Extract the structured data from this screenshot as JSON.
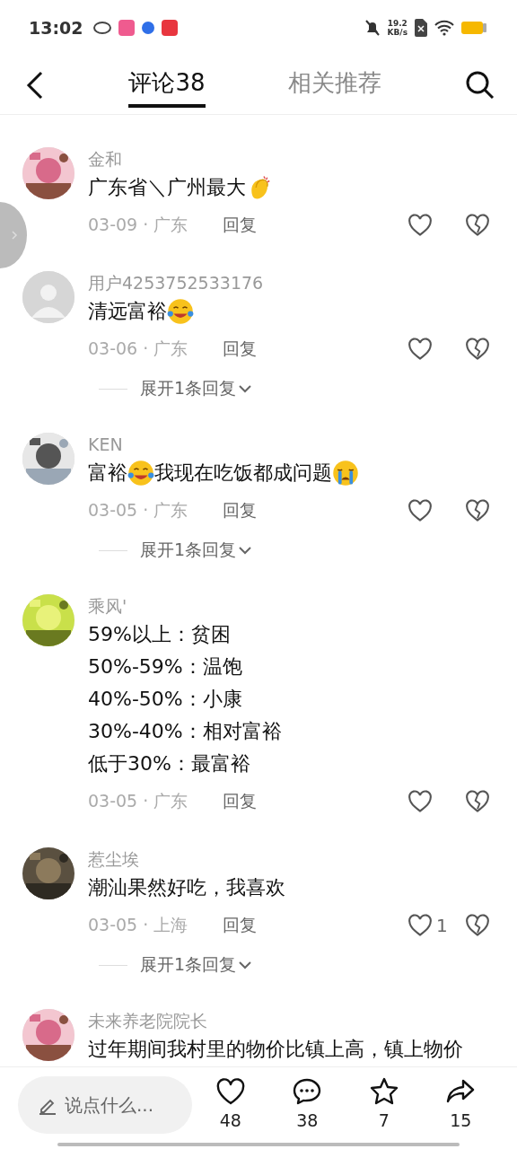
{
  "status_bar": {
    "time": "13:02",
    "speed": "19.2",
    "speed_unit": "KB/s"
  },
  "header": {
    "tabs": [
      {
        "label": "评论38",
        "selected": true
      },
      {
        "label": "相关推荐",
        "selected": false
      }
    ]
  },
  "comments": [
    {
      "name": "金和",
      "lines": [
        [
          {
            "kind": "text",
            "text": "广东省＼广州最大"
          },
          {
            "kind": "clap"
          }
        ]
      ],
      "date": "03-09 · 广东",
      "reply": "回复"
    },
    {
      "name": "用户4253752533176",
      "lines": [
        [
          {
            "kind": "text",
            "text": "清远富裕"
          },
          {
            "kind": "laugh"
          }
        ]
      ],
      "date": "03-06 · 广东",
      "reply": "回复",
      "expand": "展开1条回复"
    },
    {
      "name": "KEN",
      "lines": [
        [
          {
            "kind": "text",
            "text": "富裕"
          },
          {
            "kind": "laugh"
          },
          {
            "kind": "text",
            "text": "我现在吃饭都成问题"
          },
          {
            "kind": "cry"
          }
        ]
      ],
      "date": "03-05 · 广东",
      "reply": "回复",
      "expand": "展开1条回复"
    },
    {
      "name": "乘风'",
      "lines": [
        [
          {
            "kind": "text",
            "text": "59%以上：贫困"
          }
        ],
        [
          {
            "kind": "text",
            "text": "50%-59%：温饱"
          }
        ],
        [
          {
            "kind": "text",
            "text": "40%-50%：小康"
          }
        ],
        [
          {
            "kind": "text",
            "text": "30%-40%：相对富裕"
          }
        ],
        [
          {
            "kind": "text",
            "text": "低于30%：最富裕"
          }
        ]
      ],
      "date": "03-05 · 广东",
      "reply": "回复"
    },
    {
      "name": "惹尘埃",
      "lines": [
        [
          {
            "kind": "text",
            "text": "潮汕果然好吃，我喜欢"
          }
        ]
      ],
      "date": "03-05 · 上海",
      "reply": "回复",
      "likes": "1",
      "expand": "展开1条回复"
    },
    {
      "name": "未来养老院院长",
      "lines": [
        [
          {
            "kind": "text",
            "text": "过年期间我村里的物价比镇上高，镇上物价"
          }
        ]
      ]
    }
  ],
  "composer": {
    "placeholder": "说点什么..."
  },
  "actions": [
    {
      "kind": "heart",
      "count": "48"
    },
    {
      "kind": "comment",
      "count": "38"
    },
    {
      "kind": "star",
      "count": "7"
    },
    {
      "kind": "share",
      "count": "15"
    }
  ]
}
